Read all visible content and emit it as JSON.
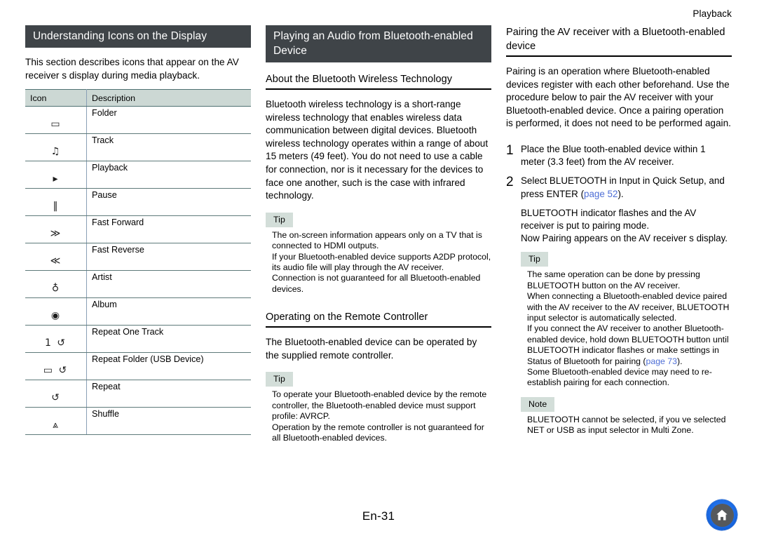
{
  "page": {
    "running_head": "Playback",
    "page_number": "En-31",
    "home_icon": "home-icon"
  },
  "left_column": {
    "title": "Understanding Icons on the Display",
    "intro": "This section describes icons that appear on the AV receiver s display during media playback.",
    "table": {
      "headers": [
        "Icon",
        "Description"
      ],
      "rows": [
        {
          "icon": "folder-icon",
          "glyph": "▭",
          "description": "Folder"
        },
        {
          "icon": "music-note-icon",
          "glyph": "♫",
          "description": "Track"
        },
        {
          "icon": "play-icon",
          "glyph": "▸",
          "description": "Playback"
        },
        {
          "icon": "pause-icon",
          "glyph": "‖",
          "description": "Pause"
        },
        {
          "icon": "fast-forward-icon",
          "glyph": "≫",
          "description": "Fast Forward"
        },
        {
          "icon": "fast-reverse-icon",
          "glyph": "≪",
          "description": "Fast Reverse"
        },
        {
          "icon": "artist-icon",
          "glyph": "♁",
          "description": "Artist"
        },
        {
          "icon": "album-icon",
          "glyph": "◉",
          "description": "Album"
        },
        {
          "icon": "repeat-one-track-icon",
          "glyph": "1 ↺",
          "description": "Repeat One Track"
        },
        {
          "icon": "repeat-folder-icon",
          "glyph": "▭ ↺",
          "description": "Repeat Folder (USB Device)"
        },
        {
          "icon": "repeat-icon",
          "glyph": "↺",
          "description": "Repeat"
        },
        {
          "icon": "shuffle-icon",
          "glyph": "⩓",
          "description": "Shuffle"
        }
      ]
    }
  },
  "middle_column": {
    "title": "Playing an Audio from Bluetooth-enabled Device",
    "section1": {
      "heading": "About the Bluetooth Wireless Technology",
      "paragraph": "Bluetooth wireless technology is a short-range wireless technology that enables wireless data communication between digital devices. Bluetooth wireless technology operates within a range of about 15 meters (49 feet). You do not need to use a cable for connection, nor is it necessary for the devices to face one another, such is the case with infrared technology.",
      "tip_label": "Tip",
      "tip_lines": [
        "The on-screen information appears only on a TV that is connected to HDMI outputs.",
        "If your Bluetooth-enabled device supports A2DP protocol, its audio file will play through the AV receiver.",
        "Connection is not guaranteed for all Bluetooth-enabled devices."
      ]
    },
    "section2": {
      "heading": "Operating on the Remote Controller",
      "paragraph": "The Bluetooth-enabled device can be operated by the supplied remote controller.",
      "tip_label": "Tip",
      "tip_lines": [
        "To operate your Bluetooth-enabled device by the remote controller, the Bluetooth-enabled device must support profile: AVRCP.",
        "Operation by the remote controller is not guaranteed for all Bluetooth-enabled devices."
      ]
    }
  },
  "right_column": {
    "heading": "Pairing the AV receiver with a Bluetooth-enabled device",
    "paragraph": "Pairing is an operation where Bluetooth-enabled devices register with each other beforehand. Use the procedure below to pair the AV receiver with your Bluetooth-enabled device. Once a pairing operation is performed, it does not need to be performed again.",
    "steps": [
      {
        "number": "1",
        "text": "Place the Blue tooth-enabled device within 1 meter (3.3 feet) from the AV receiver."
      },
      {
        "number": "2",
        "text_before_link": "Select  BLUETOOTH  in  Input  in Quick Setup, and press ENTER (",
        "link": "page 52",
        "text_after_link": ").",
        "continuation": "BLUETOOTH  indicator flashes and the AV receiver is put to pairing mode.",
        "continuation2": " Now Pairing  appears on the AV receiver s display."
      }
    ],
    "tip_label": "Tip",
    "tip_lines": [
      "The same operation can be done by pressing BLUETOOTH button on the AV receiver.",
      "When connecting a Bluetooth-enabled device paired with the AV receiver to the AV receiver, BLUETOOTH input selector is automatically selected."
    ],
    "tip_line_link": {
      "before": "If you connect the AV receiver to another Bluetooth-enabled device, hold down BLUETOOTH button until BLUETOOTH  indicator flashes or make settings in  Status  of  Bluetooth   for pairing (",
      "link": "page 73",
      "after": ")."
    },
    "tip_last_line": "Some Bluetooth-enabled device may need to re-establish pairing for each connection.",
    "note_label": "Note",
    "note_lines": [
      " BLUETOOTH  cannot be selected, if you ve selected NET or USB as input selector in Multi Zone."
    ]
  },
  "colors": {
    "heading_bar": "#3f4448",
    "table_header": "#ccd8d4",
    "badge": "#d3ded9",
    "link": "#4f6fd6",
    "home_button": "#1f6fe8"
  }
}
